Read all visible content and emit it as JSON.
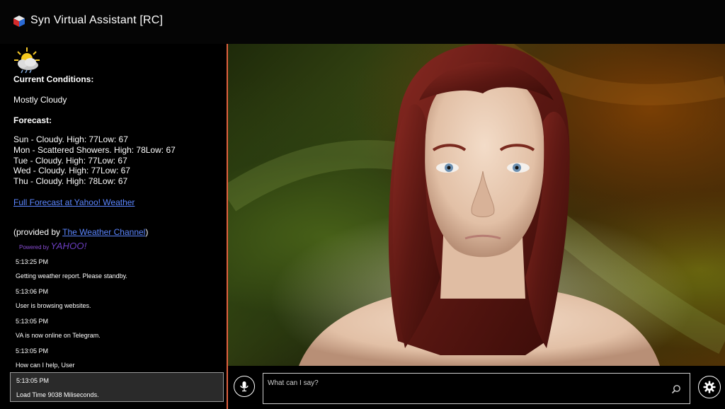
{
  "app": {
    "title": "Syn Virtual Assistant [RC]"
  },
  "weather": {
    "icon": "partly-cloudy-icon",
    "current_heading": "Current Conditions:",
    "current": "Mostly Cloudy",
    "forecast_heading": "Forecast:",
    "forecast": [
      "Sun - Cloudy. High: 77Low: 67",
      "Mon - Scattered Showers. High: 78Low: 67",
      "Tue - Cloudy. High: 77Low: 67",
      "Wed - Cloudy. High: 77Low: 67",
      "Thu - Cloudy. High: 78Low: 67"
    ],
    "full_forecast_link": "Full Forecast at Yahoo! Weather",
    "provided_prefix": "(provided by ",
    "provided_link": "The Weather Channel",
    "provided_suffix": ")",
    "powered_by": "Powered by",
    "yahoo": "YAHOO!"
  },
  "log": [
    {
      "time": "5:13:25 PM",
      "message": "Getting weather report. Please standby."
    },
    {
      "time": "5:13:06 PM",
      "message": "User is browsing websites."
    },
    {
      "time": "5:13:05 PM",
      "message": "VA is now online on Telegram."
    },
    {
      "time": "5:13:05 PM",
      "message": "How can I help, User"
    },
    {
      "time": "5:13:05 PM",
      "message": "Load Time 9038 Miliseconds."
    }
  ],
  "input": {
    "placeholder": "What can I say?",
    "value": ""
  },
  "colors": {
    "splitter": "#e0603f",
    "link": "#5b86ff",
    "yahoo": "#6d3fc4"
  },
  "icons": {
    "mic": "microphone-icon",
    "search": "search-icon",
    "settings": "gear-icon",
    "app": "app-logo-icon"
  }
}
